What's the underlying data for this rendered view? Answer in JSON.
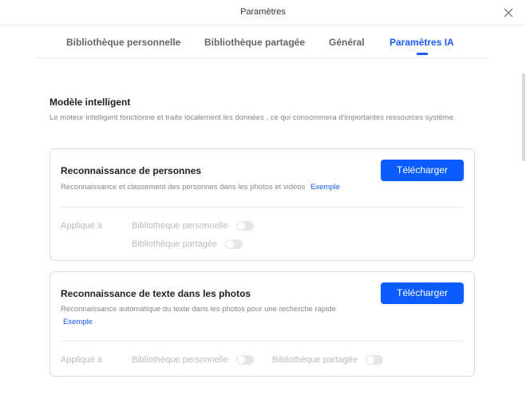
{
  "window": {
    "title": "Paramètres"
  },
  "tabs": [
    {
      "label": "Bibliothèque personnelle"
    },
    {
      "label": "Bibliothèque partagée"
    },
    {
      "label": "Général"
    },
    {
      "label": "Paramètres IA"
    }
  ],
  "active_tab": "Paramètres IA",
  "section": {
    "title": "Modèle intelligent",
    "description": "Le moteur intelligent fonctionne et traite localement les données , ce qui consommera d'importantes ressources système."
  },
  "cards": [
    {
      "title": "Reconnaissance de personnes",
      "description": "Reconnaissance et classement des personnes dans les photos et vidéos",
      "link": "Exemple",
      "button": "Télécharger",
      "applied_label": "Appliqué à",
      "options": [
        {
          "label": "Bibliothèque personnelle",
          "enabled": false
        },
        {
          "label": "Bibliothèque partagée",
          "enabled": false
        }
      ]
    },
    {
      "title": "Reconnaissance de texte dans les photos",
      "description": "Reconnaissance automatique du texte dans les photos pour une recherche rapide",
      "link": "Exemple",
      "button": "Télécharger",
      "applied_label": "Appliqué à",
      "options": [
        {
          "label": "Bibliothèque personnelle",
          "enabled": false
        },
        {
          "label": "Bibliothèque partagée",
          "enabled": false
        }
      ]
    }
  ],
  "colors": {
    "accent": "#1a5cff",
    "button": "#0a5cff",
    "muted": "#888888",
    "disabled": "#bbbbbb"
  },
  "icons": {
    "close": "close-icon"
  }
}
